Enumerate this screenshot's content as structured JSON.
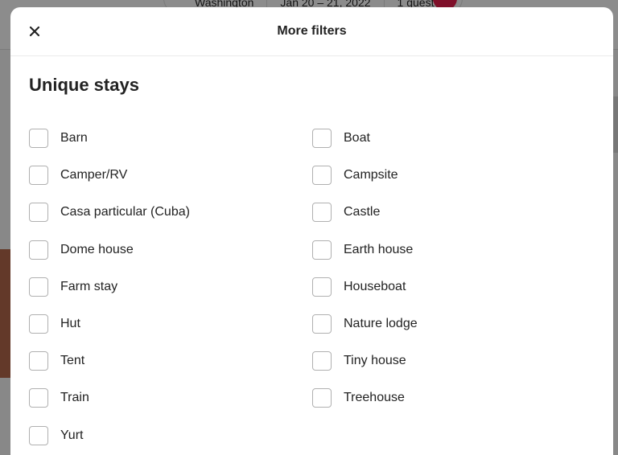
{
  "background": {
    "search_pill": {
      "location": "Washington",
      "dates": "Jan 20 – 21, 2022",
      "guests": "1 guest"
    }
  },
  "modal": {
    "title": "More filters",
    "close_icon": "close-icon",
    "section_title": "Unique stays",
    "options": [
      {
        "label": "Barn",
        "checked": false
      },
      {
        "label": "Boat",
        "checked": false
      },
      {
        "label": "Camper/RV",
        "checked": false
      },
      {
        "label": "Campsite",
        "checked": false
      },
      {
        "label": "Casa particular (Cuba)",
        "checked": false
      },
      {
        "label": "Castle",
        "checked": false
      },
      {
        "label": "Dome house",
        "checked": false
      },
      {
        "label": "Earth house",
        "checked": false
      },
      {
        "label": "Farm stay",
        "checked": false
      },
      {
        "label": "Houseboat",
        "checked": false
      },
      {
        "label": "Hut",
        "checked": false
      },
      {
        "label": "Nature lodge",
        "checked": false
      },
      {
        "label": "Tent",
        "checked": false
      },
      {
        "label": "Tiny house",
        "checked": false
      },
      {
        "label": "Train",
        "checked": false
      },
      {
        "label": "Treehouse",
        "checked": false
      },
      {
        "label": "Yurt",
        "checked": false
      }
    ]
  },
  "colors": {
    "overlay": "#8a8a8a",
    "accent": "#e61e4d",
    "text": "#222222",
    "checkbox_border": "#b0b0b0"
  }
}
